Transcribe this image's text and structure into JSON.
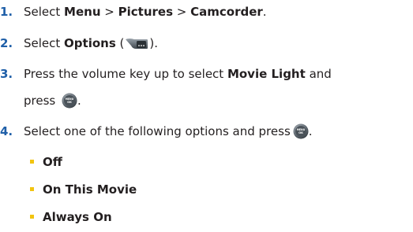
{
  "steps": [
    {
      "num": "1.",
      "pre": "Select ",
      "menu": "Menu",
      "sep1": " > ",
      "pictures": "Pictures",
      "sep2": " > ",
      "camcorder": "Camcorder",
      "post": "."
    },
    {
      "num": "2.",
      "pre": "Select ",
      "options": "Options",
      "open": " (",
      "close": ")."
    },
    {
      "num": "3.",
      "pre": "Press the volume key up to select ",
      "movie_light": "Movie Light",
      "post": " and",
      "line2": "press",
      "end": "."
    },
    {
      "num": "4.",
      "pre": "Select one of the following options and press",
      "end": "."
    }
  ],
  "options_list": [
    "Off",
    "On This Movie",
    "Always On"
  ],
  "colors": {
    "step_number": "#1f5fa8",
    "text": "#231f20",
    "bullet": "#f2c40f"
  },
  "icons": {
    "softkey": "options-softkey-icon",
    "ok": "menu-ok-key-icon"
  }
}
